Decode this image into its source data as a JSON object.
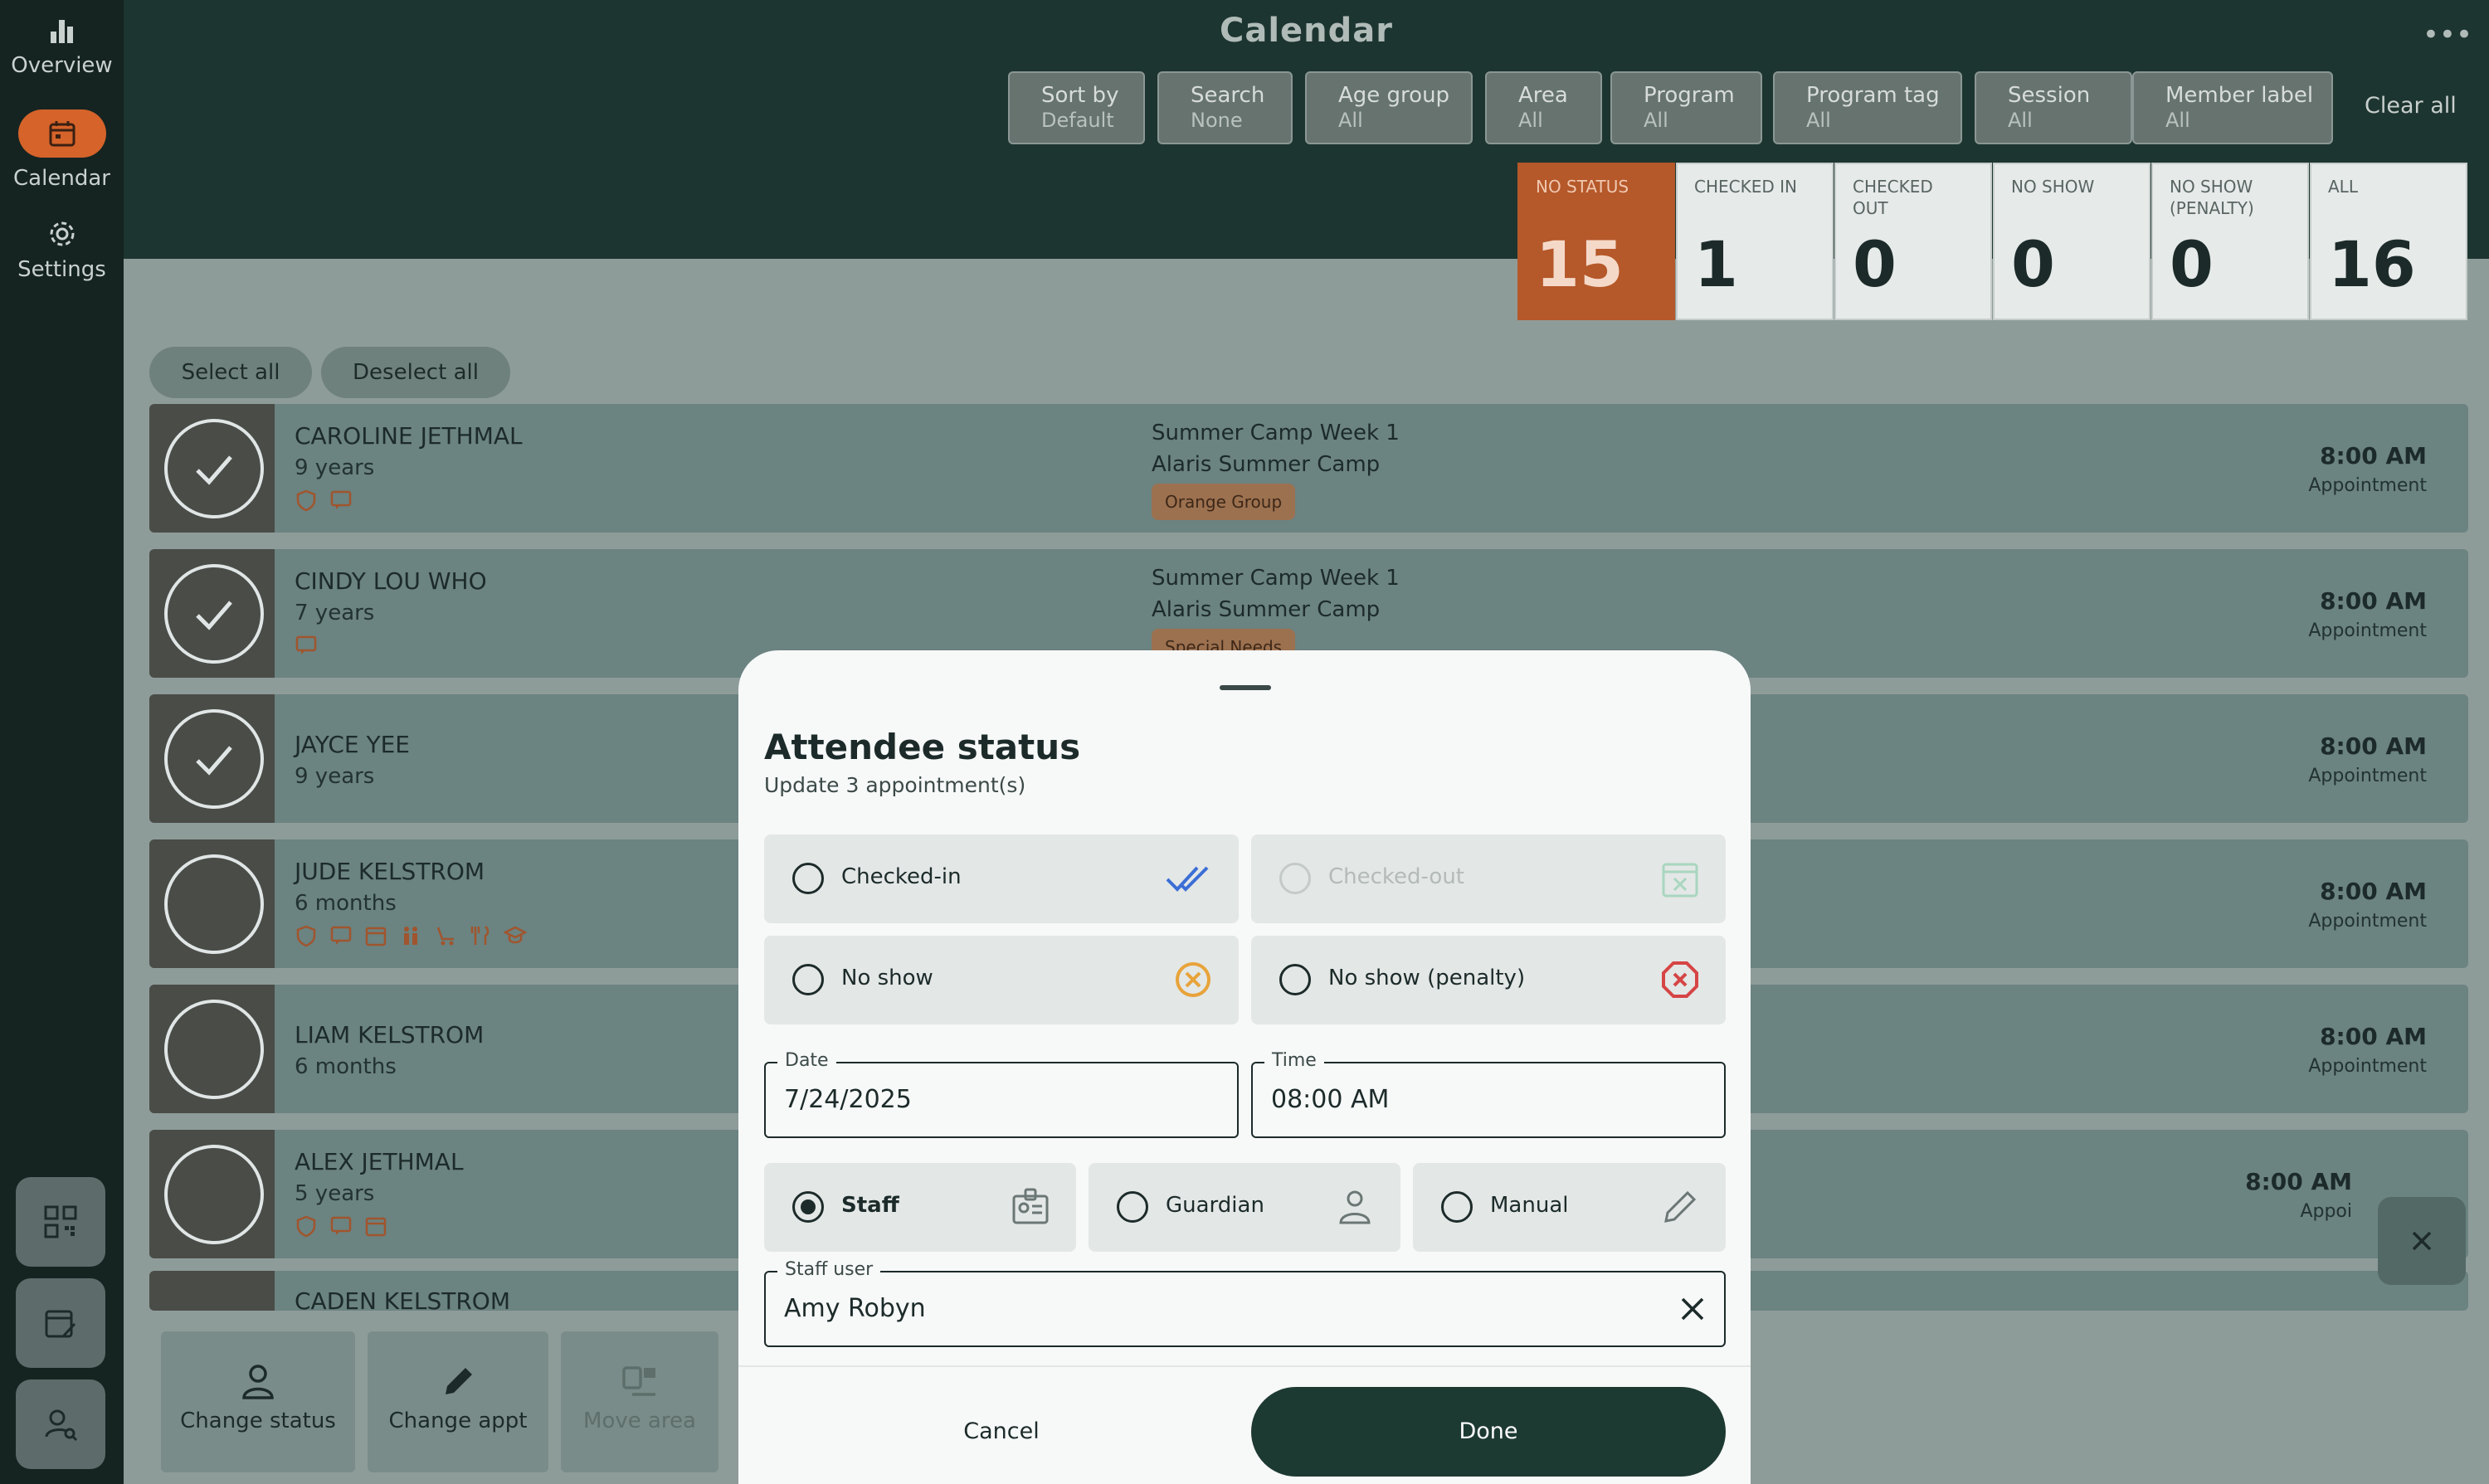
{
  "sidebar": {
    "items": [
      {
        "label": "Overview"
      },
      {
        "label": "Calendar"
      },
      {
        "label": "Settings"
      }
    ]
  },
  "header": {
    "title": "Calendar",
    "filters": [
      {
        "label": "Sort by",
        "value": "Default"
      },
      {
        "label": "Search",
        "value": "None"
      },
      {
        "label": "Age group",
        "value": "All"
      },
      {
        "label": "Area",
        "value": "All"
      },
      {
        "label": "Program",
        "value": "All"
      },
      {
        "label": "Program tag",
        "value": "All"
      },
      {
        "label": "Session",
        "value": "All"
      },
      {
        "label": "Member label",
        "value": "All"
      }
    ],
    "clear_all": "Clear all"
  },
  "stats": [
    {
      "label": "NO STATUS",
      "value": "15"
    },
    {
      "label": "CHECKED IN",
      "value": "1"
    },
    {
      "label": "CHECKED OUT",
      "value": "0"
    },
    {
      "label": "NO SHOW",
      "value": "0"
    },
    {
      "label": "NO SHOW (PENALTY)",
      "value": "0"
    },
    {
      "label": "ALL",
      "value": "16"
    }
  ],
  "colors": {
    "accent": "#d5632a",
    "primary": "#1d3a32",
    "alert_orange": "#e8a33a",
    "alert_red": "#d64545"
  },
  "list": {
    "select_all": "Select all",
    "deselect_all": "Deselect all",
    "rows": [
      {
        "name": "CAROLINE JETHMAL",
        "age": "9 years",
        "program": "Summer Camp Week 1",
        "camp": "Alaris Summer Camp",
        "tag": "Orange Group",
        "time": "8:00 AM",
        "type": "Appointment"
      },
      {
        "name": "CINDY LOU WHO",
        "age": "7 years",
        "program": "Summer Camp Week 1",
        "camp": "Alaris Summer Camp",
        "tag": "Special Needs",
        "time": "8:00 AM",
        "type": "Appointment"
      },
      {
        "name": "JAYCE YEE",
        "age": "9 years",
        "time": "8:00 AM",
        "type": "Appointment"
      },
      {
        "name": "JUDE KELSTROM",
        "age": "6 months",
        "time": "8:00 AM",
        "type": "Appointment"
      },
      {
        "name": "LIAM KELSTROM",
        "age": "6 months",
        "time": "8:00 AM",
        "type": "Appointment"
      },
      {
        "name": "ALEX JETHMAL",
        "age": "5 years",
        "time": "8:00 AM",
        "type": "Appoi"
      },
      {
        "name": "CADEN KELSTROM"
      }
    ]
  },
  "toolbar": {
    "change_status": "Change status",
    "change_appt": "Change appt",
    "move_area": "Move area"
  },
  "modal": {
    "title": "Attendee status",
    "subtitle": "Update 3 appointment(s)",
    "status_options": [
      {
        "label": "Checked-in"
      },
      {
        "label": "Checked-out"
      },
      {
        "label": "No show"
      },
      {
        "label": "No show (penalty)"
      }
    ],
    "date": {
      "label": "Date",
      "value": "7/24/2025"
    },
    "time": {
      "label": "Time",
      "value": "08:00 AM"
    },
    "by_options": [
      {
        "label": "Staff",
        "selected": true
      },
      {
        "label": "Guardian"
      },
      {
        "label": "Manual"
      }
    ],
    "staff_user": {
      "label": "Staff user",
      "value": "Amy Robyn"
    },
    "cancel": "Cancel",
    "done": "Done"
  }
}
